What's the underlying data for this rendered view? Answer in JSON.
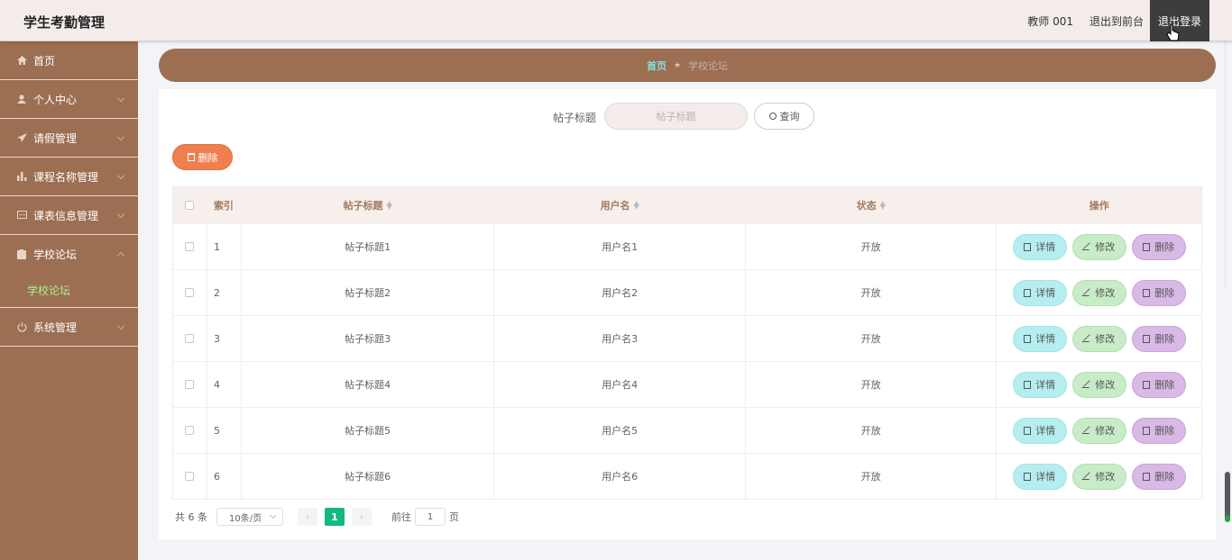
{
  "header": {
    "title": "学生考勤管理",
    "user": "教师 001",
    "to_front": "退出到前台",
    "logout": "退出登录"
  },
  "sidebar": {
    "items": [
      {
        "label": "首页",
        "icon": "home-icon"
      },
      {
        "label": "个人中心",
        "icon": "user-icon"
      },
      {
        "label": "请假管理",
        "icon": "send-icon"
      },
      {
        "label": "课程名称管理",
        "icon": "chart-icon"
      },
      {
        "label": "课表信息管理",
        "icon": "message-icon"
      },
      {
        "label": "学校论坛",
        "icon": "clipboard-icon",
        "expanded": true,
        "children": [
          "学校论坛"
        ]
      },
      {
        "label": "系统管理",
        "icon": "power-icon"
      }
    ]
  },
  "breadcrumb": {
    "home": "首页",
    "current": "学校论坛"
  },
  "search": {
    "label": "帖子标题",
    "placeholder": "帖子标题",
    "query_button": "查询"
  },
  "toolbar": {
    "delete_label": "删除"
  },
  "table": {
    "headers": [
      "索引",
      "帖子标题",
      "用户名",
      "状态",
      "操作"
    ],
    "rows": [
      {
        "index": "1",
        "title": "帖子标题1",
        "user": "用户名1",
        "status": "开放"
      },
      {
        "index": "2",
        "title": "帖子标题2",
        "user": "用户名2",
        "status": "开放"
      },
      {
        "index": "3",
        "title": "帖子标题3",
        "user": "用户名3",
        "status": "开放"
      },
      {
        "index": "4",
        "title": "帖子标题4",
        "user": "用户名4",
        "status": "开放"
      },
      {
        "index": "5",
        "title": "帖子标题5",
        "user": "用户名5",
        "status": "开放"
      },
      {
        "index": "6",
        "title": "帖子标题6",
        "user": "用户名6",
        "status": "开放"
      }
    ],
    "actions": {
      "detail": "详情",
      "edit": "修改",
      "delete": "删除"
    }
  },
  "pagination": {
    "total": "共 6 条",
    "page_size": "10条/页",
    "current_page": "1",
    "goto_prefix": "前往",
    "goto_value": "1",
    "goto_suffix": "页"
  },
  "colors": {
    "sidebar": "#9c6e52",
    "header": "#f3ecea",
    "accent_green": "#13b97f",
    "delete_orange": "#f07f4f"
  }
}
